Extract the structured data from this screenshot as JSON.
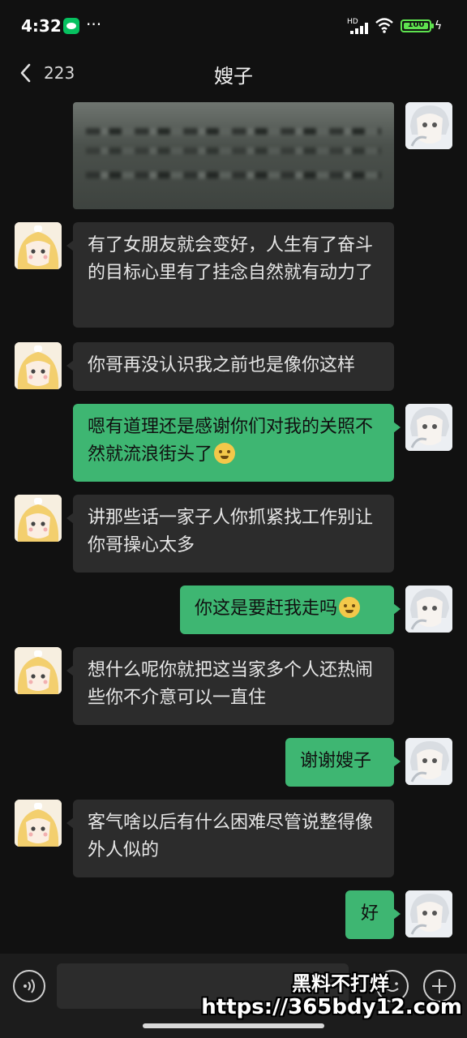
{
  "status_bar": {
    "time": "4:32",
    "more": "···",
    "network": "HD",
    "battery_level": "100"
  },
  "nav": {
    "unread_count": "223",
    "title": "嫂子"
  },
  "messages": [
    {
      "side": "right",
      "type": "image"
    },
    {
      "side": "left",
      "text": "有了女朋友就会变好，人生有了奋斗的目标心里有了挂念自然就有动力了"
    },
    {
      "side": "left",
      "text": "你哥再没认识我之前也是像你这样"
    },
    {
      "side": "right",
      "text": "嗯有道理还是感谢你们对我的关照不然就流浪街头了"
    },
    {
      "side": "left",
      "text": "讲那些话一家子人你抓紧找工作别让你哥操心太多"
    },
    {
      "side": "right",
      "text": "你这是要赶我走吗"
    },
    {
      "side": "left",
      "text": "想什么呢你就把这当家多个人还热闹些你不介意可以一直住"
    },
    {
      "side": "right",
      "text": "谢谢嫂子"
    },
    {
      "side": "left",
      "text": "客气啥以后有什么困难尽管说整得像外人似的"
    },
    {
      "side": "right",
      "text": "好"
    }
  ],
  "input_bar": {
    "placeholder": ""
  },
  "watermark": {
    "line1": "黑料不打烊",
    "line2": "https://365bdy12.com"
  },
  "colors": {
    "background": "#111111",
    "bubble_left": "#2c2c2c",
    "bubble_right": "#3eb672",
    "battery": "#5ee24f"
  }
}
